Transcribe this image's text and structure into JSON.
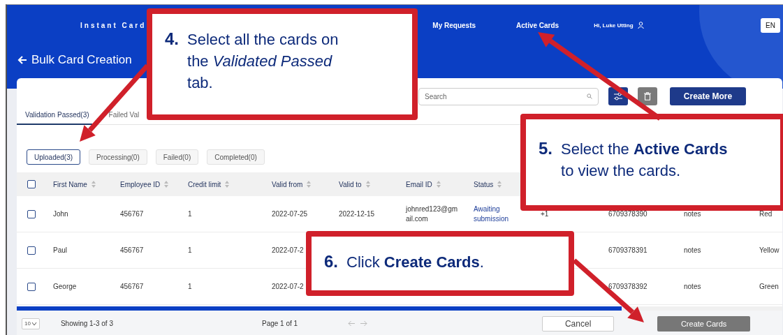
{
  "header": {
    "brand": "Instant Card",
    "nav": [
      {
        "label": "My Requests"
      },
      {
        "label": "Active Cards"
      }
    ],
    "greeting": "Hi, Luke Utting",
    "language": "EN",
    "page_title": "Bulk Card Creation"
  },
  "toolbar": {
    "search": {
      "placeholder": "Search"
    },
    "delete_disabled": true,
    "create_more": "Create More"
  },
  "tabs": [
    {
      "label": "Validation Passed(3)",
      "selected": true
    },
    {
      "label": "Failed Val",
      "selected": false
    }
  ],
  "filters": [
    {
      "label": "Uploaded(3)",
      "selected": true
    },
    {
      "label": "Processing(0)",
      "selected": false
    },
    {
      "label": "Failed(0)",
      "selected": false
    },
    {
      "label": "Completed(0)",
      "selected": false
    }
  ],
  "table": {
    "select_all_checked": false,
    "columns": [
      "First Name",
      "Employee ID",
      "Credit limit",
      "Valid from",
      "Valid to",
      "Email ID",
      "Status"
    ],
    "rows": [
      {
        "checked": false,
        "cells": [
          "John",
          "456767",
          "1",
          "2022-07-25",
          "2022-12-15",
          "johnred123@gmail.com",
          "Awaiting submission",
          "+1",
          "6709378390",
          "notes",
          "Red"
        ]
      },
      {
        "checked": false,
        "cells": [
          "Paul",
          "456767",
          "1",
          "2022-07-2",
          null,
          null,
          null,
          null,
          "6709378391",
          "notes",
          "Yellow"
        ]
      },
      {
        "checked": false,
        "cells": [
          "George",
          "456767",
          "1",
          "2022-07-2",
          null,
          null,
          null,
          null,
          "6709378392",
          "notes",
          "Green"
        ]
      }
    ]
  },
  "footer": {
    "page_size": "10",
    "showing": "Showing 1-3 of 3",
    "page": "Page 1 of 1",
    "cancel": "Cancel",
    "create": {
      "label": "Create Cards",
      "disabled": true
    }
  },
  "callouts": [
    {
      "number": "4.",
      "text": "Select all the cards on the *Validated Passed* tab."
    },
    {
      "number": "5.",
      "text": "Select the **Active Cards** to view the cards."
    },
    {
      "number": "6.",
      "text": "Click **Create Cards**."
    }
  ]
}
